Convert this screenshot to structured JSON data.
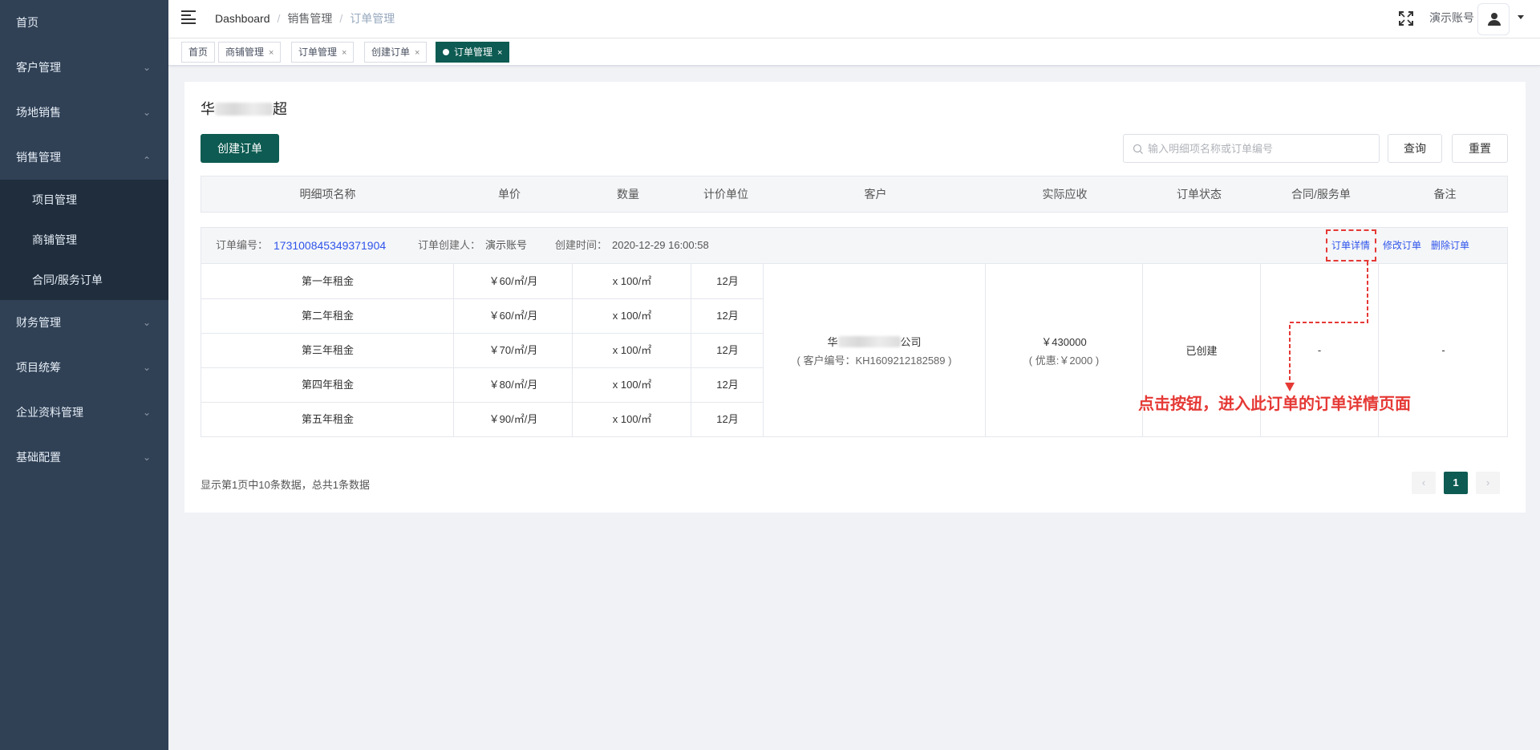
{
  "sidebar": {
    "items": [
      {
        "label": "首页"
      },
      {
        "label": "客户管理"
      },
      {
        "label": "场地销售"
      },
      {
        "label": "销售管理"
      },
      {
        "label": "财务管理"
      },
      {
        "label": "项目统筹"
      },
      {
        "label": "企业资料管理"
      },
      {
        "label": "基础配置"
      }
    ],
    "submenu": [
      {
        "label": "项目管理"
      },
      {
        "label": "商铺管理"
      },
      {
        "label": "合同/服务订单"
      }
    ]
  },
  "header": {
    "breadcrumb": [
      "Dashboard",
      "销售管理",
      "订单管理"
    ],
    "account": "演示账号"
  },
  "tags": [
    {
      "label": "首页"
    },
    {
      "label": "商铺管理"
    },
    {
      "label": "订单管理"
    },
    {
      "label": "创建订单"
    },
    {
      "label": "订单管理"
    }
  ],
  "card": {
    "title_prefix": "华",
    "title_suffix": "超",
    "create_button": "创建订单",
    "search_placeholder": "输入明细项名称或订单编号",
    "query_button": "查询",
    "reset_button": "重置"
  },
  "table": {
    "columns": [
      "明细项名称",
      "单价",
      "数量",
      "计价单位",
      "客户",
      "实际应收",
      "订单状态",
      "合同/服务单",
      "备注"
    ]
  },
  "order": {
    "no_label": "订单编号：",
    "no": "173100845349371904",
    "creator_label": "订单创建人：",
    "creator": "演示账号",
    "time_label": "创建时间：",
    "time": "2020-12-29 16:00:58",
    "actions": [
      "订单详情",
      "修改订单",
      "删除订单"
    ],
    "items": [
      {
        "name": "第一年租金",
        "price": "￥60/㎡/月",
        "qty": "x 100/㎡",
        "unit": "12月"
      },
      {
        "name": "第二年租金",
        "price": "￥60/㎡/月",
        "qty": "x 100/㎡",
        "unit": "12月"
      },
      {
        "name": "第三年租金",
        "price": "￥70/㎡/月",
        "qty": "x 100/㎡",
        "unit": "12月"
      },
      {
        "name": "第四年租金",
        "price": "￥80/㎡/月",
        "qty": "x 100/㎡",
        "unit": "12月"
      },
      {
        "name": "第五年租金",
        "price": "￥90/㎡/月",
        "qty": "x 100/㎡",
        "unit": "12月"
      }
    ],
    "customer_prefix": "华",
    "customer_suffix": "公司",
    "customer_code": "( 客户编号：KH1609212182589 )",
    "amount": "￥430000",
    "discount": "( 优惠:￥2000 )",
    "status": "已创建",
    "contract": "-",
    "remark": "-"
  },
  "annotation": "点击按钮，进入此订单的订单详情页面",
  "pager": {
    "info_prefix": "显示第",
    "page": "1",
    "info_mid1": "页中",
    "size": "10",
    "info_mid2": "条数据，总共",
    "total": "1",
    "info_suffix": "条数据",
    "current": "1"
  },
  "colors": {
    "primary": "#0d5b52",
    "sidebar": "#304156",
    "link": "#2f54eb",
    "annotation": "#e53935"
  }
}
